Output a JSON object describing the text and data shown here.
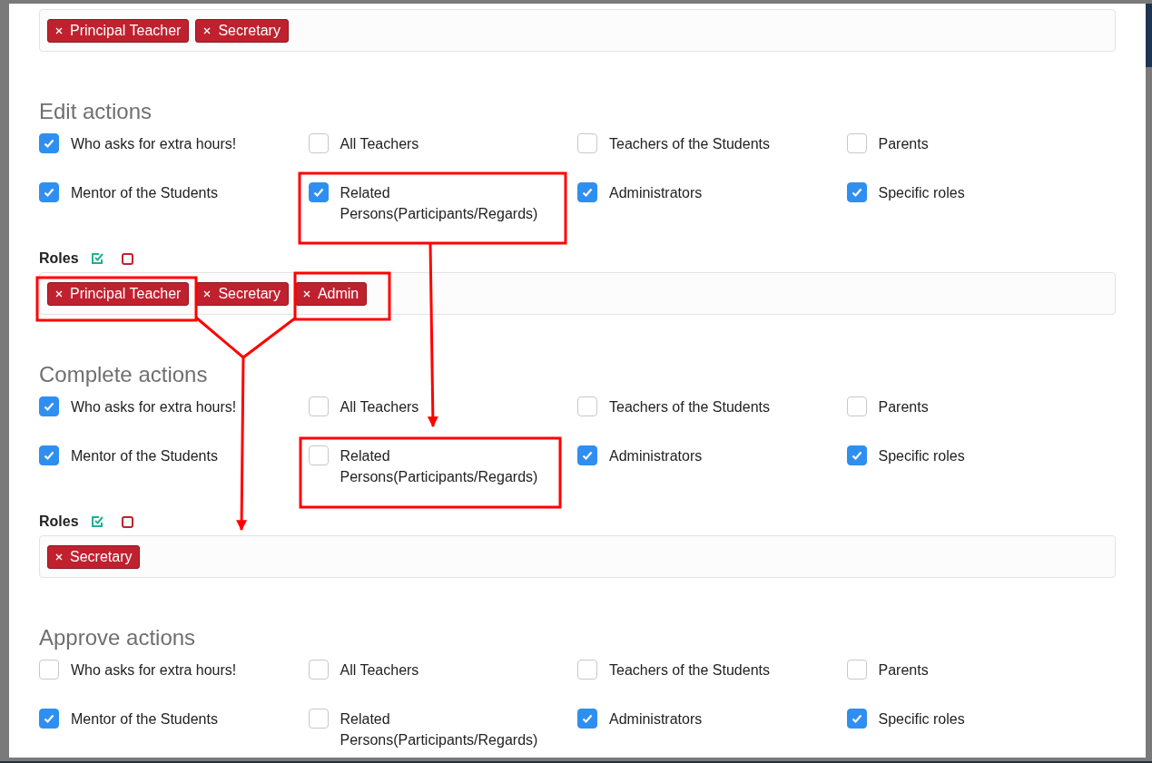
{
  "top_roles": {
    "tags": [
      "Principal Teacher",
      "Secretary"
    ]
  },
  "sections": [
    {
      "title": "Edit actions",
      "options": [
        {
          "label": "Who asks for extra hours!",
          "checked": true
        },
        {
          "label": "All Teachers",
          "checked": false
        },
        {
          "label": "Teachers of the Students",
          "checked": false
        },
        {
          "label": "Parents",
          "checked": false
        },
        {
          "label": "Mentor of the Students",
          "checked": true
        },
        {
          "label": "Related Persons(Participants/Regards)",
          "checked": true
        },
        {
          "label": "Administrators",
          "checked": true
        },
        {
          "label": "Specific roles",
          "checked": true
        }
      ],
      "roles": {
        "label": "Roles",
        "tags": [
          "Principal Teacher",
          "Secretary",
          "Admin"
        ]
      }
    },
    {
      "title": "Complete actions",
      "options": [
        {
          "label": "Who asks for extra hours!",
          "checked": true
        },
        {
          "label": "All Teachers",
          "checked": false
        },
        {
          "label": "Teachers of the Students",
          "checked": false
        },
        {
          "label": "Parents",
          "checked": false
        },
        {
          "label": "Mentor of the Students",
          "checked": true
        },
        {
          "label": "Related Persons(Participants/Regards)",
          "checked": false
        },
        {
          "label": "Administrators",
          "checked": true
        },
        {
          "label": "Specific roles",
          "checked": true
        }
      ],
      "roles": {
        "label": "Roles",
        "tags": [
          "Secretary"
        ]
      }
    },
    {
      "title": "Approve actions",
      "options": [
        {
          "label": "Who asks for extra hours!",
          "checked": false
        },
        {
          "label": "All Teachers",
          "checked": false
        },
        {
          "label": "Teachers of the Students",
          "checked": false
        },
        {
          "label": "Parents",
          "checked": false
        },
        {
          "label": "Mentor of the Students",
          "checked": true
        },
        {
          "label": "Related Persons(Participants/Regards)",
          "checked": false
        },
        {
          "label": "Administrators",
          "checked": true
        },
        {
          "label": "Specific roles",
          "checked": true
        }
      ]
    }
  ]
}
